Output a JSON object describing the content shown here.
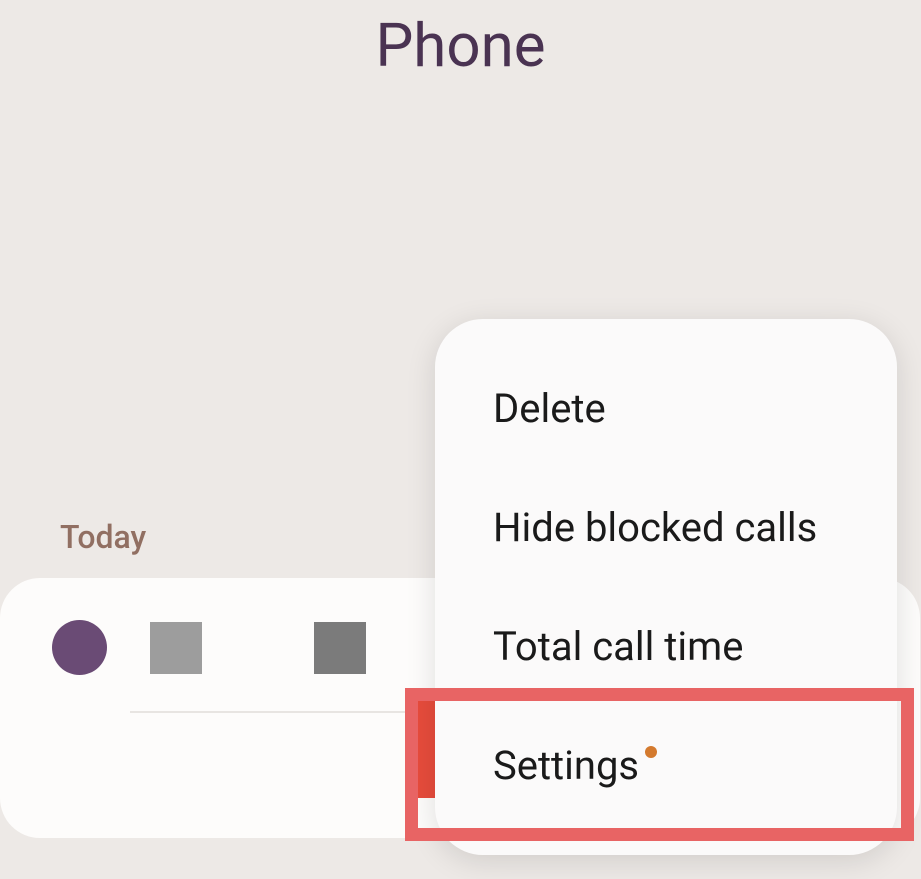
{
  "header": {
    "title": "Phone"
  },
  "section": {
    "label": "Today"
  },
  "menu": {
    "items": [
      {
        "label": "Delete"
      },
      {
        "label": "Hide blocked calls"
      },
      {
        "label": "Total call time"
      },
      {
        "label": "Settings",
        "notification": true
      }
    ]
  }
}
